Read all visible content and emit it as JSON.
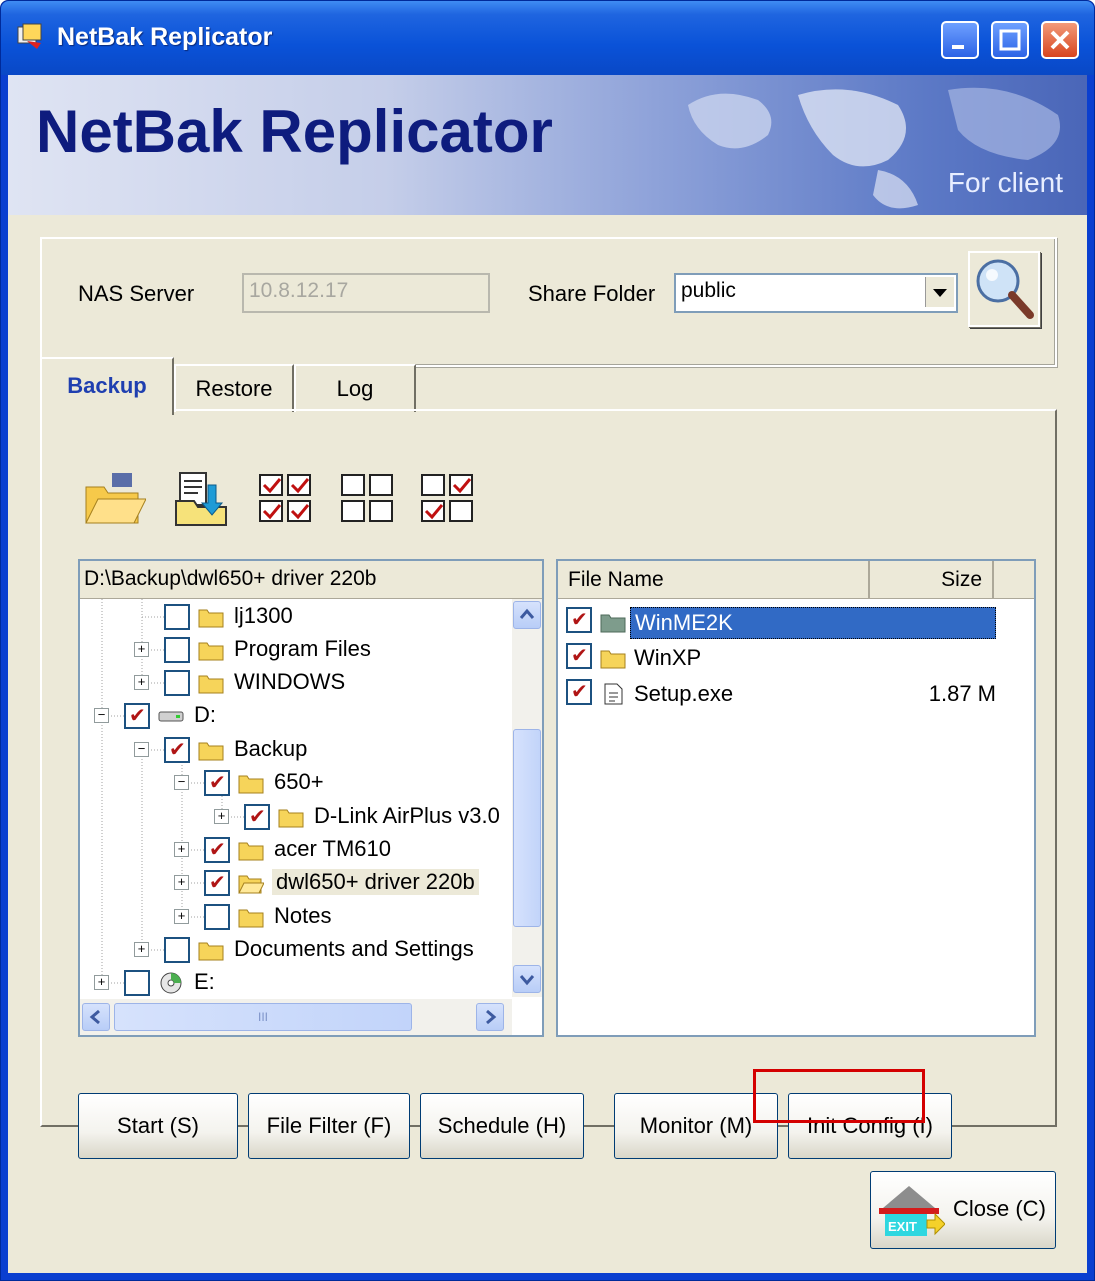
{
  "window": {
    "title": "NetBak Replicator"
  },
  "banner": {
    "title": "NetBak Replicator",
    "subtitle": "For client"
  },
  "server": {
    "nas_label": "NAS Server",
    "nas_value": "10.8.12.17",
    "share_label": "Share Folder",
    "share_value": "public"
  },
  "tabs": [
    {
      "label": "Backup"
    },
    {
      "label": "Restore"
    },
    {
      "label": "Log"
    }
  ],
  "tree": {
    "path": "D:\\Backup\\dwl650+ driver 220b",
    "nodes": [
      {
        "label": "lj1300"
      },
      {
        "label": "Program Files"
      },
      {
        "label": "WINDOWS"
      },
      {
        "label": "D:"
      },
      {
        "label": "Backup"
      },
      {
        "label": "650+"
      },
      {
        "label": "D-Link AirPlus v3.0"
      },
      {
        "label": "acer TM610"
      },
      {
        "label": "dwl650+ driver 220b"
      },
      {
        "label": "Notes"
      },
      {
        "label": "Documents and Settings"
      },
      {
        "label": "E:"
      }
    ],
    "scroll_thumb": "III"
  },
  "filelist": {
    "col_name": "File Name",
    "col_size": "Size",
    "rows": [
      {
        "name": "WinME2K",
        "size": ""
      },
      {
        "name": "WinXP",
        "size": ""
      },
      {
        "name": "Setup.exe",
        "size": "1.87 M"
      }
    ]
  },
  "buttons": {
    "start": "Start (S)",
    "filter": "File Filter (F)",
    "schedule": "Schedule (H)",
    "monitor": "Monitor (M)",
    "init": "Init Config (I)",
    "close": "Close (C)",
    "exit_badge": "EXIT"
  }
}
